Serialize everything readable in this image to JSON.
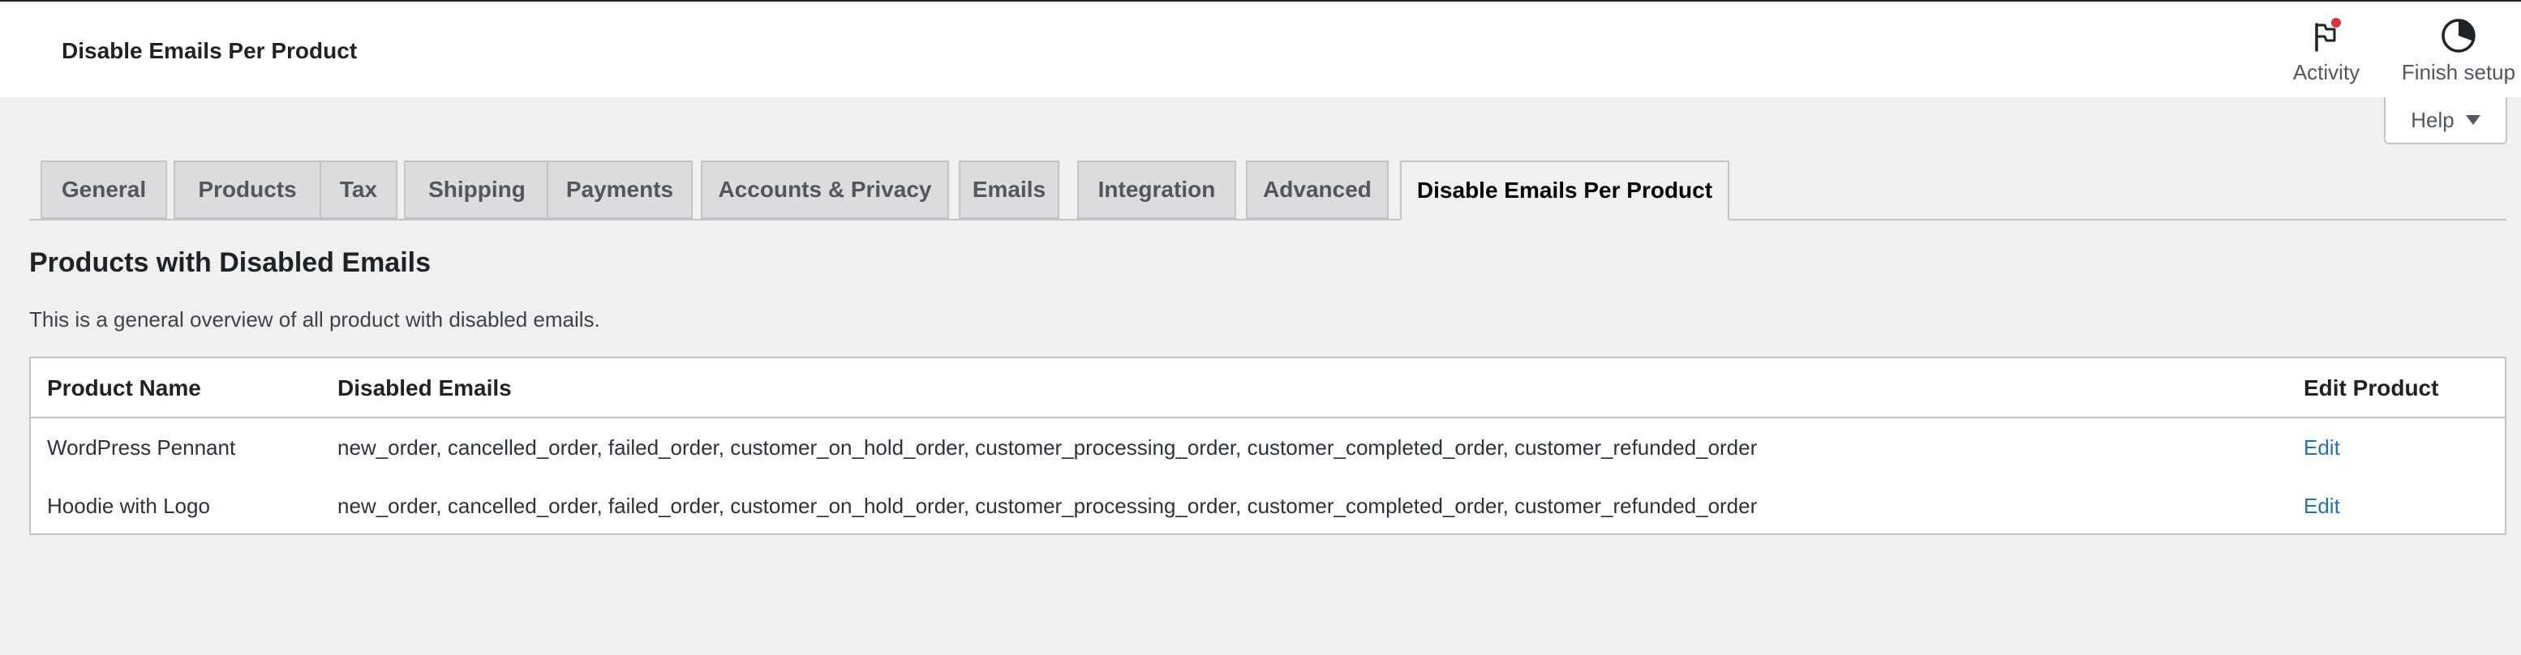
{
  "header": {
    "title": "Disable Emails Per Product",
    "actions": [
      {
        "label": "Activity",
        "icon": "flag-icon"
      },
      {
        "label": "Finish setup",
        "icon": "progress-circle-icon"
      }
    ],
    "help_label": "Help"
  },
  "tabs": [
    {
      "label": "General"
    },
    {
      "label": "Products"
    },
    {
      "label": "Tax"
    },
    {
      "label": "Shipping"
    },
    {
      "label": "Payments"
    },
    {
      "label": "Accounts & Privacy"
    },
    {
      "label": "Emails"
    },
    {
      "label": "Integration"
    },
    {
      "label": "Advanced"
    },
    {
      "label": "Disable Emails Per Product",
      "active": true
    }
  ],
  "section": {
    "title": "Products with Disabled Emails",
    "description": "This is a general overview of all product with disabled emails."
  },
  "table": {
    "columns": [
      "Product Name",
      "Disabled Emails",
      "Edit Product"
    ],
    "rows": [
      {
        "product": "WordPress Pennant",
        "emails": "new_order, cancelled_order, failed_order, customer_on_hold_order, customer_processing_order, customer_completed_order, customer_refunded_order",
        "edit": "Edit"
      },
      {
        "product": "Hoodie with Logo",
        "emails": "new_order, cancelled_order, failed_order, customer_on_hold_order, customer_processing_order, customer_completed_order, customer_refunded_order",
        "edit": "Edit"
      }
    ]
  },
  "colors": {
    "accent": "#2271b1",
    "notification_dot": "#d63638",
    "background": "#f0f0f1"
  }
}
